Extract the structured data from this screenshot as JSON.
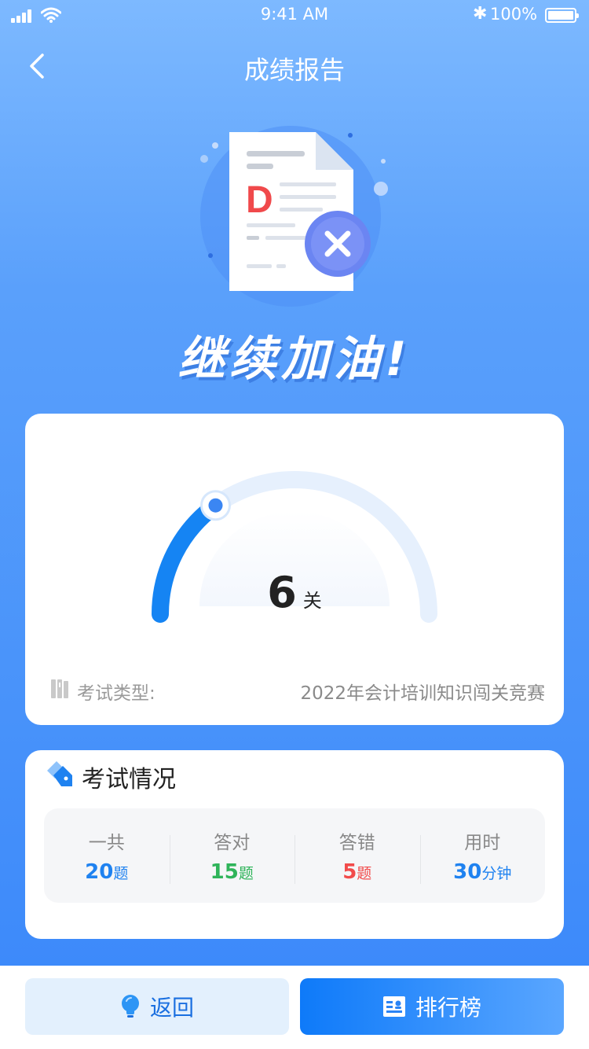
{
  "status_bar": {
    "time": "9:41 AM",
    "battery": "100%"
  },
  "nav": {
    "title": "成绩报告"
  },
  "illustration": {
    "grade": "D"
  },
  "headline": "继续加油!",
  "result": {
    "value": "6",
    "unit": "关",
    "gauge_progress": 0.3,
    "exam_type_label": "考试类型:",
    "exam_type_value": "2022年会计培训知识闯关竞赛"
  },
  "exam": {
    "title": "考试情况",
    "stats": [
      {
        "label": "一共",
        "value": "20",
        "unit": "题",
        "color": "#1f82f0"
      },
      {
        "label": "答对",
        "value": "15",
        "unit": "题",
        "color": "#2fb45a"
      },
      {
        "label": "答错",
        "value": "5",
        "unit": "题",
        "color": "#f24b4b"
      },
      {
        "label": "用时",
        "value": "30",
        "unit": "分钟",
        "color": "#1f82f0"
      }
    ]
  },
  "buttons": {
    "back": "返回",
    "rank": "排行榜"
  },
  "colors": {
    "primary": "#0e7af9",
    "bg_top": "#7db9ff",
    "bg_bottom": "#3d8afa"
  }
}
